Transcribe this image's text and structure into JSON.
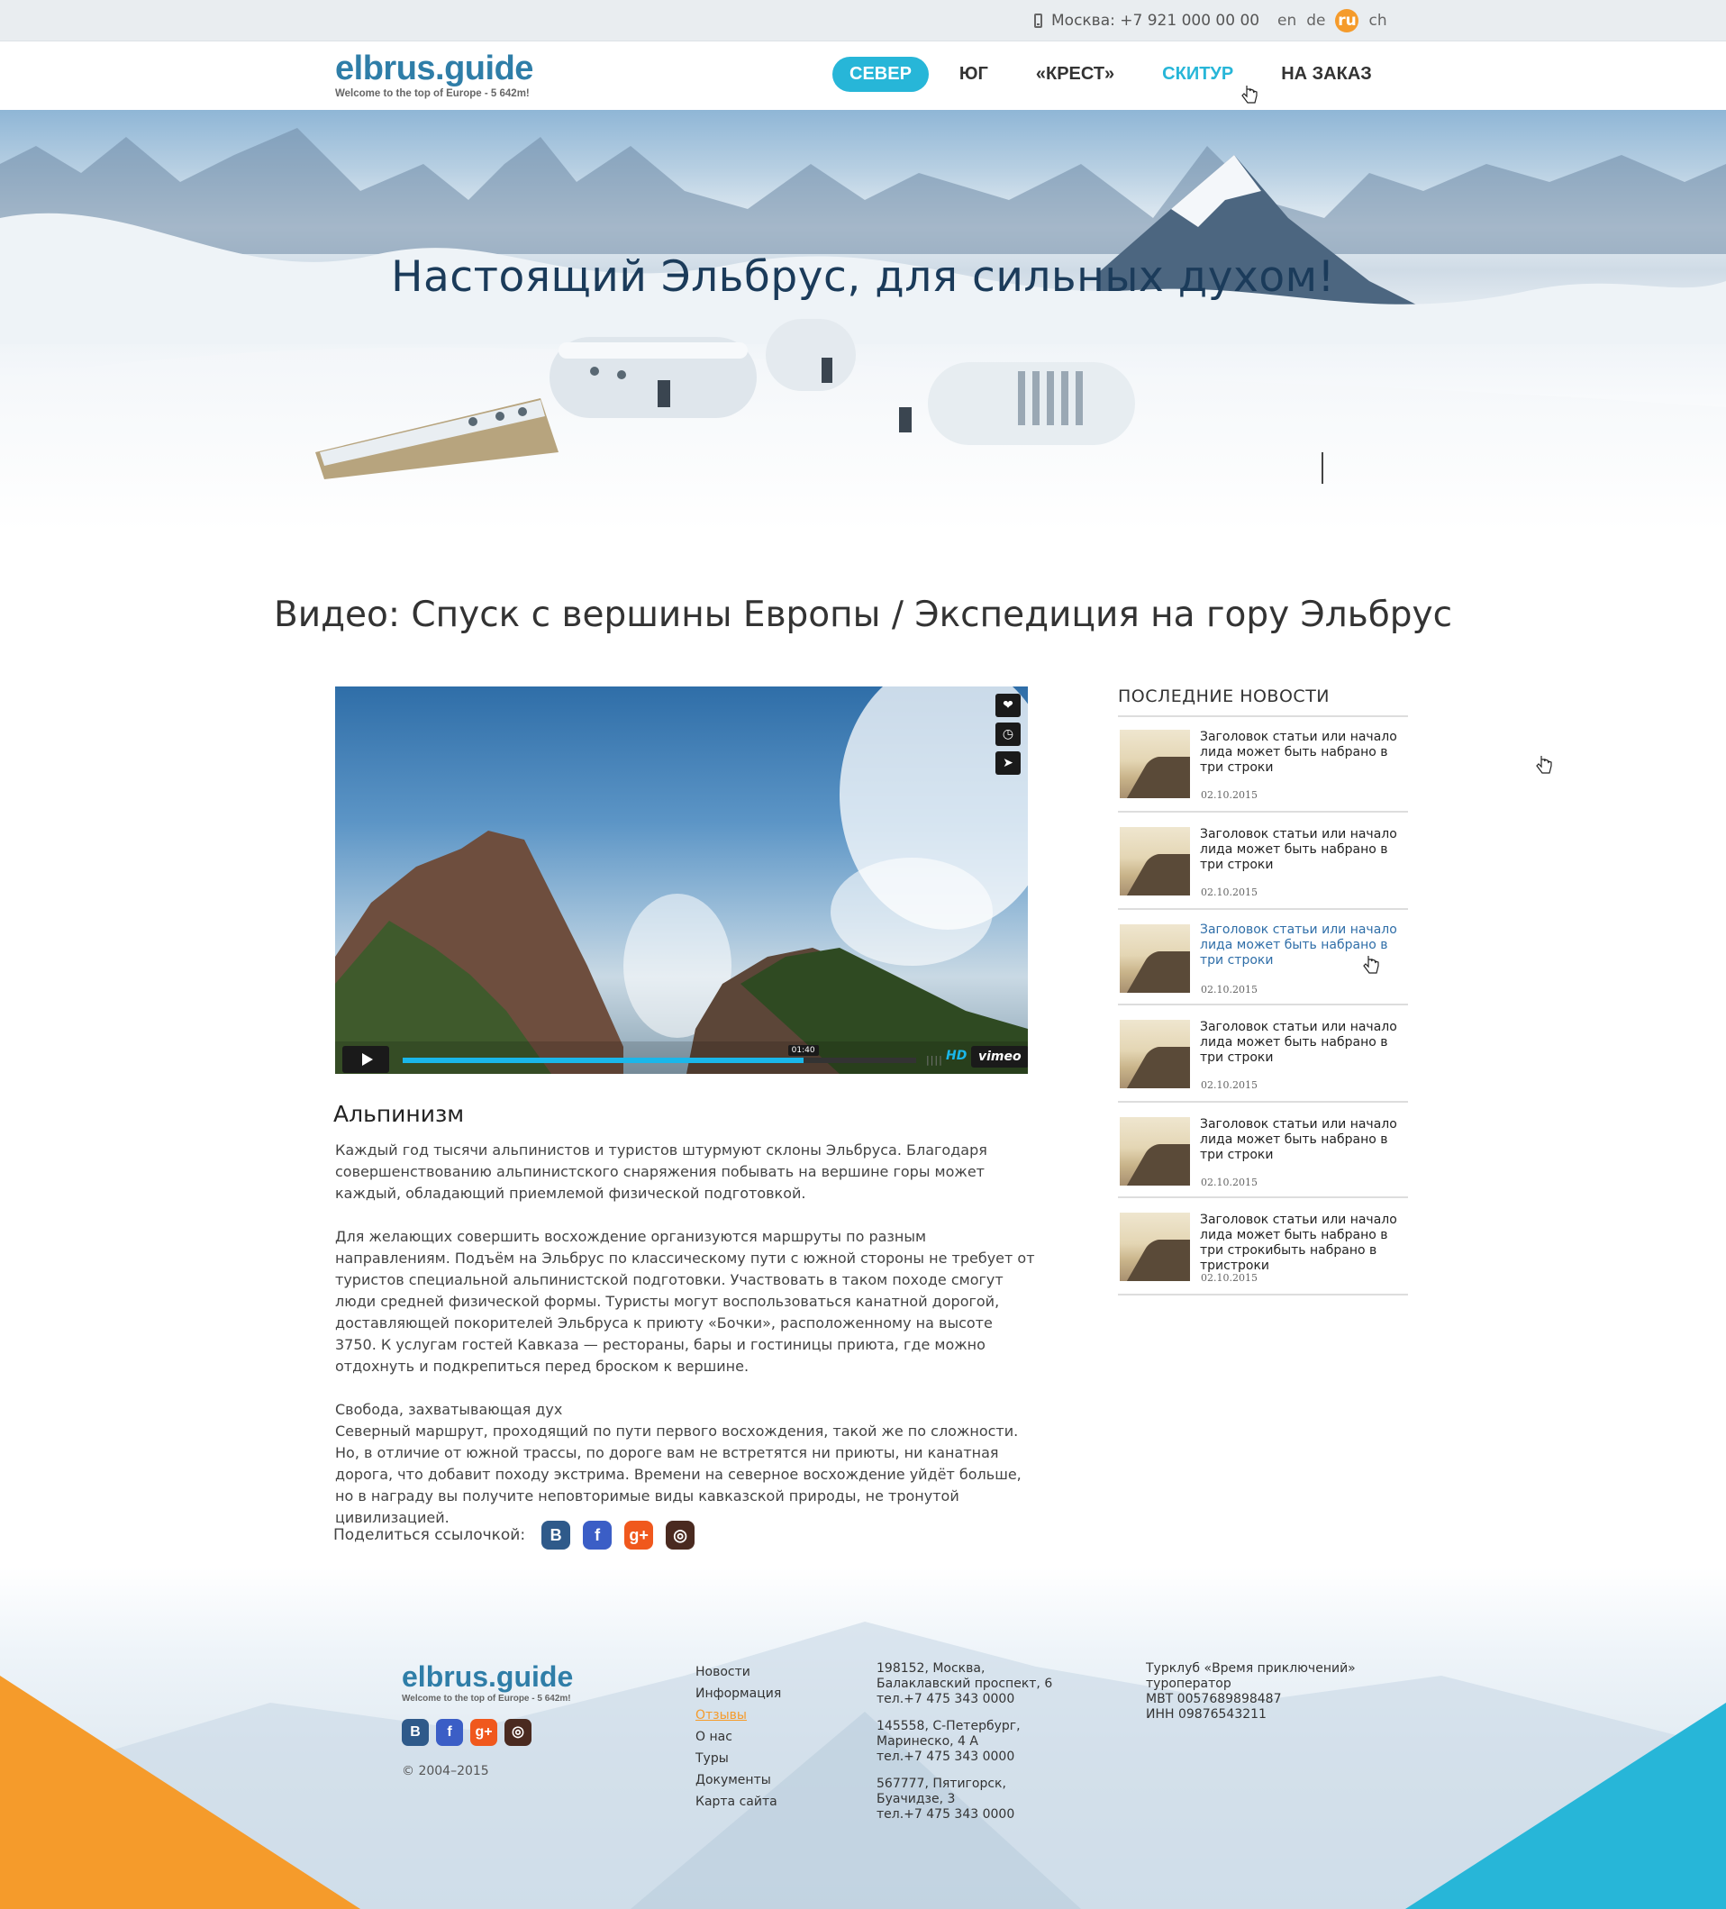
{
  "topbar": {
    "phone": "Москва: +7 921 000 00 00",
    "languages": [
      "en",
      "de",
      "ru",
      "ch"
    ],
    "active_language": "ru"
  },
  "header": {
    "logo": "elbrus.guide",
    "tagline": "Welcome to the top of Europe - 5 642m!",
    "nav": [
      "СЕВЕР",
      "ЮГ",
      "«КРЕСТ»",
      "СКИТУР",
      "НА ЗАКАЗ"
    ]
  },
  "hero": {
    "title": "Настоящий Эльбрус, для сильных духом!"
  },
  "page": {
    "title": "Видео: Спуск с вершины Европы / Экспедиция на гору Эльбрус"
  },
  "video": {
    "time": "01:40",
    "progress": 0.78,
    "hd": "HD",
    "provider": "vimeo"
  },
  "article": {
    "heading": "Альпинизм",
    "p1": "Каждый год тысячи альпинистов и туристов штурмуют склоны Эльбруса. Благодаря совершенствованию альпинистского снаряжения побывать на вершине горы может каждый, обладающий приемлемой физической подготовкой.",
    "p2": "Для желающих совершить восхождение организуются маршруты по разным направлениям. Подъём на Эльбрус по классическому пути с южной стороны не требует от туристов специальной альпинистской подготовки. Участвовать в таком походе смогут люди средней физической формы. Туристы могут воспользоваться канатной дорогой, доставляющей покорителей Эльбруса к приюту «Бочки», расположенному на высоте 3750. К услугам гостей Кавказа — рестораны, бары и гостиницы приюта, где можно отдохнуть и подкрепиться перед броском к вершине.",
    "p3_title": "Свобода, захватывающая дух",
    "p3": "Северный маршрут, проходящий по пути первого восхождения, такой же по сложности. Но, в отличие от южной трассы, по дороге вам не встретятся ни приюты, ни канатная дорога, что добавит походу экстрима. Времени на северное восхождение уйдёт больше, но в награду вы получите неповторимые виды кавказской природы, не тронутой цивилизацией."
  },
  "share": {
    "label": "Поделиться ссылочкой:",
    "icons": [
      "В",
      "f",
      "g+",
      "◎"
    ]
  },
  "sidebar": {
    "heading": "ПОСЛЕДНИЕ НОВОСТИ",
    "news": [
      {
        "title": "Заголовок статьи или  начало лида может быть набрано в три строки",
        "date": "02.10.2015"
      },
      {
        "title": "Заголовок статьи или  начало лида может быть набрано в три строки",
        "date": "02.10.2015"
      },
      {
        "title": "Заголовок статьи или  начало лида может быть набрано в три строки",
        "date": "02.10.2015"
      },
      {
        "title": "Заголовок статьи или  начало лида может быть набрано в три строки",
        "date": "02.10.2015"
      },
      {
        "title": "Заголовок статьи или  начало лида может быть набрано в три строки",
        "date": "02.10.2015"
      },
      {
        "title": "Заголовок статьи или  начало лида может быть набрано в три строкибыть набрано в тристроки",
        "date": "02.10.2015"
      }
    ]
  },
  "footer": {
    "logo": "elbrus.guide",
    "tagline": "Welcome to the top of Europe - 5 642m!",
    "copyright": "© 2004–2015",
    "menu": [
      "Новости",
      "Информация",
      "Отзывы",
      "О нас",
      "Туры",
      "Документы",
      "Карта сайта"
    ],
    "addresses": [
      [
        "198152, Москва,",
        "Балаклавский проспект, 6",
        "тел.+7 475 343 0000"
      ],
      [
        "145558, С-Петербург,",
        "Маринеско, 4 А",
        "тел.+7 475 343 0000"
      ],
      [
        "567777, Пятигорск,",
        "Буачидзе, 3",
        "тел.+7 475 343 0000"
      ]
    ],
    "company": [
      "Турклуб «Время приключений»",
      "туроператор",
      "МВТ 0057689898487",
      "ИНН 09876543211"
    ]
  },
  "colors": {
    "accent_blue": "#27b6d8",
    "accent_orange": "#f59b2b",
    "brand_blue": "#2f7ea8"
  }
}
